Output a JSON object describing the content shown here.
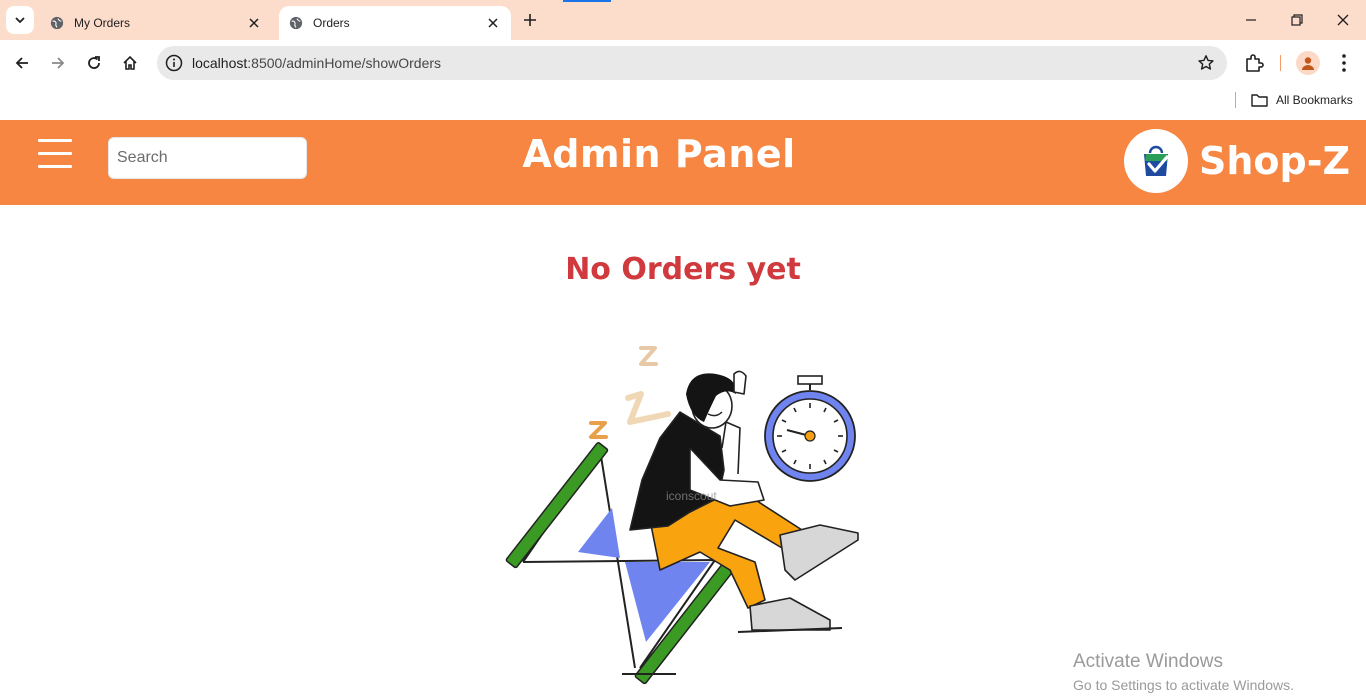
{
  "browser": {
    "tabs": [
      {
        "title": "My Orders",
        "active": false
      },
      {
        "title": "Orders",
        "active": true
      }
    ],
    "address_bar": {
      "host": "localhost",
      "path": ":8500/adminHome/showOrders"
    },
    "bookmarks_label": "All Bookmarks"
  },
  "header": {
    "search_placeholder": "Search",
    "title": "Admin Panel",
    "brand": "Shop-Z",
    "background_color": "#f68642"
  },
  "main": {
    "empty_message": "No Orders yet",
    "illustration_icon": "sleeping-person-hourglass-illustration",
    "illustration_watermark": "iconscout"
  },
  "os_overlay": {
    "line1": "Activate Windows",
    "line2": "Go to Settings to activate Windows."
  }
}
